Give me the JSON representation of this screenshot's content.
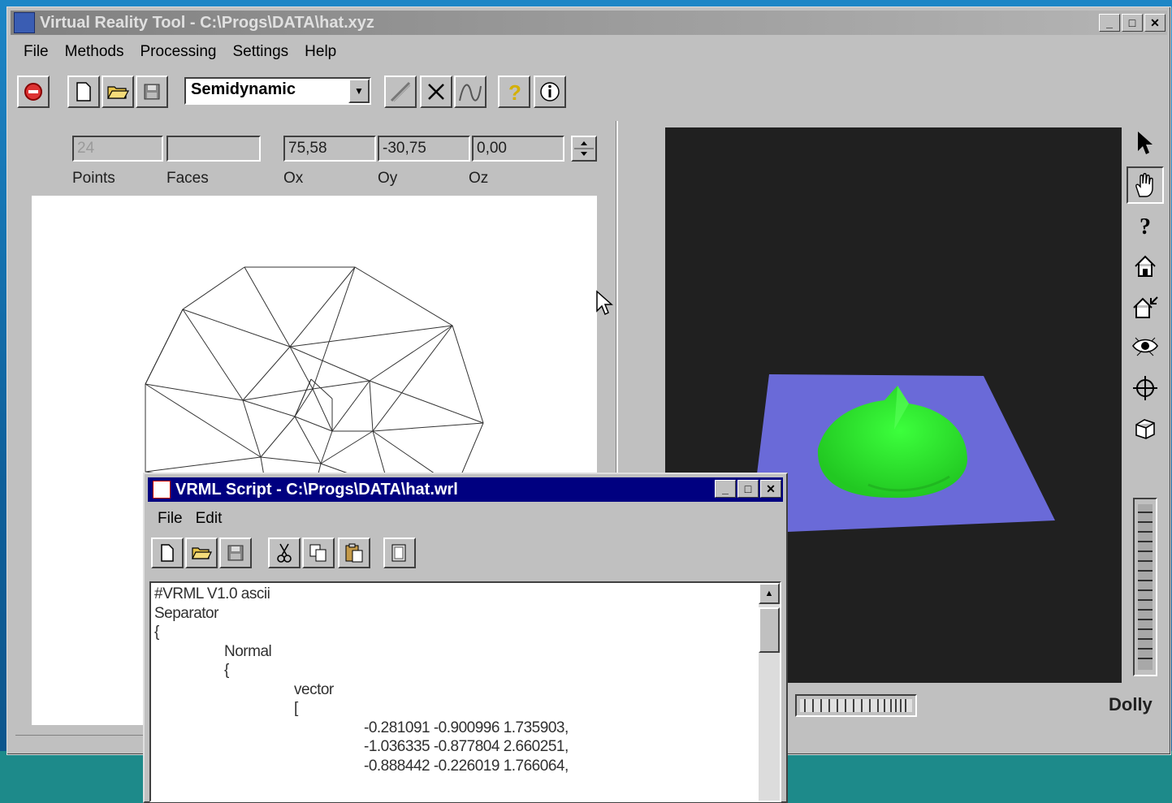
{
  "main_window": {
    "title": "Virtual Reality Tool - C:\\Progs\\DATA\\hat.xyz",
    "menu": [
      "File",
      "Methods",
      "Processing",
      "Settings",
      "Help"
    ],
    "mode_combo_value": "Semidynamic",
    "fields": {
      "points": "24",
      "faces": "",
      "ox": "75,58",
      "oy": "-30,75",
      "oz": "0,00"
    },
    "labels": {
      "points": "Points",
      "faces": "Faces",
      "ox": "Ox",
      "oy": "Oy",
      "oz": "Oz"
    },
    "viewer_mode_label": "Dolly",
    "colors": {
      "viewer_bg": "#202020",
      "plane": "#6a6ad8",
      "surface": "#2ee82e"
    }
  },
  "vrml_window": {
    "title": "VRML Script - C:\\Progs\\DATA\\hat.wrl",
    "menu": [
      "File",
      "Edit"
    ],
    "code_lines": [
      "#VRML V1.0 ascii",
      "",
      "Separator",
      "{",
      "\t\tNormal",
      "\t\t{",
      "\t\t\t\tvector",
      "\t\t\t\t[",
      "\t\t\t\t\t\t-0.281091 -0.900996 1.735903,",
      "\t\t\t\t\t\t-1.036335 -0.877804 2.660251,",
      "\t\t\t\t\t\t-0.888442 -0.226019 1.766064,"
    ]
  }
}
